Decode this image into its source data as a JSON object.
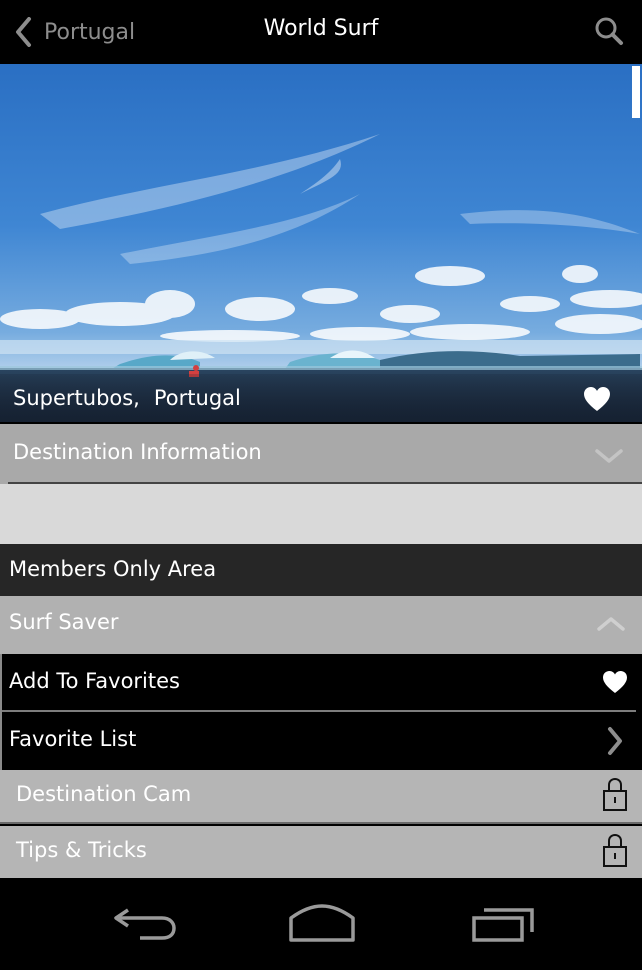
{
  "header": {
    "back_label": "Portugal",
    "title": "World Surf"
  },
  "hero": {
    "spot": "Supertubos,",
    "country": "Portugal"
  },
  "sections": {
    "destination_info": "Destination Information",
    "members_area": "Members Only Area",
    "surf_saver": "Surf Saver"
  },
  "menu": {
    "add_favorites": "Add To Favorites",
    "favorite_list": "Favorite List",
    "destination_cam": "Destination Cam",
    "tips_tricks": "Tips & Tricks"
  },
  "colors": {
    "header_bg": "#000000",
    "section_grey": "#a9a9a9",
    "members_bar": "#262626",
    "locked_row": "#b5b5b5"
  },
  "icons": [
    "back-chevron-icon",
    "search-icon",
    "heart-icon",
    "chevron-down-icon",
    "chevron-up-icon",
    "chevron-right-icon",
    "lock-icon",
    "nav-back-icon",
    "nav-home-icon",
    "nav-recent-apps-icon"
  ]
}
